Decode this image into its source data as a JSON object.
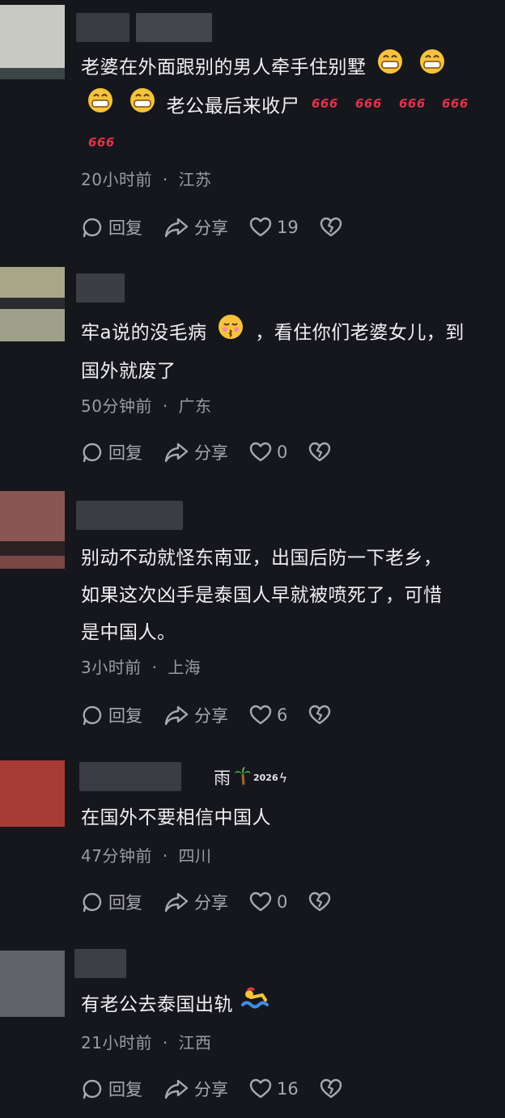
{
  "comments": [
    {
      "text_lines": [
        "老婆在外面跟别的男人牵手住别墅",
        "老公最后来收尸"
      ],
      "emoji": [
        "grin-emoji",
        "sixsixsix-emoji"
      ],
      "time": "20小时前",
      "location": "江苏",
      "meta_sep": "·",
      "reply_label": "回复",
      "share_label": "分享",
      "likes": "19"
    },
    {
      "text_lines": [
        "牢a说的没毛病",
        "，看住你们老婆女儿，到",
        "国外就废了"
      ],
      "emoji": [
        "kiss-emoji"
      ],
      "time": "50分钟前",
      "location": "广东",
      "meta_sep": "·",
      "reply_label": "回复",
      "share_label": "分享",
      "likes": "0"
    },
    {
      "text_lines": [
        "别动不动就怪东南亚，出国后防一下老乡，",
        "如果这次凶手是泰国人早就被喷死了，可惜",
        "是中国人。"
      ],
      "time": "3小时前",
      "location": "上海",
      "meta_sep": "·",
      "reply_label": "回复",
      "share_label": "分享",
      "likes": "6"
    },
    {
      "username_suffix": "雨",
      "username_tag": "2026",
      "text_lines": [
        "在国外不要相信中国人"
      ],
      "time": "47分钟前",
      "location": "四川",
      "meta_sep": "·",
      "reply_label": "回复",
      "share_label": "分享",
      "likes": "0"
    },
    {
      "text_lines": [
        "有老公去泰国出轨"
      ],
      "emoji": [
        "swimmer-emoji"
      ],
      "time": "21小时前",
      "location": "江西",
      "meta_sep": "·",
      "reply_label": "回复",
      "share_label": "分享",
      "likes": "16"
    }
  ],
  "colors": {
    "background": "#16171d",
    "meta": "#9a9ba3",
    "action": "#a8a9b0",
    "emoji_six": "#e0334a",
    "emoji_grin": "#f6c33c"
  }
}
